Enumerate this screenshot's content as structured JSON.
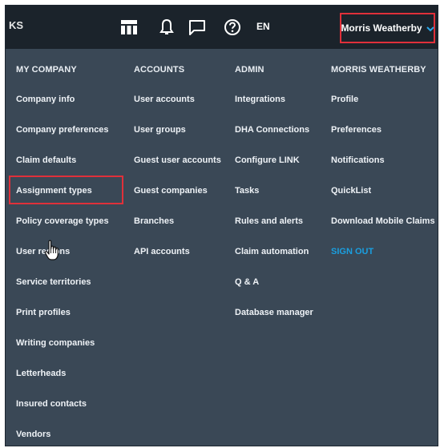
{
  "topbar": {
    "partial_label": "KS",
    "lang": "EN",
    "user_name": "Morris Weatherby",
    "icons": [
      "table-icon",
      "bell-icon",
      "chat-icon",
      "help-icon",
      "chevron-down-icon"
    ]
  },
  "menu": {
    "columns": [
      {
        "heading": "MY COMPANY",
        "items": [
          "Company info",
          "Company preferences",
          "Claim defaults",
          "Assignment types",
          "Policy coverage types",
          "User regions",
          "Service territories",
          "Print profiles",
          "Writing companies",
          "Letterheads",
          "Insured contacts",
          "Vendors"
        ]
      },
      {
        "heading": "ACCOUNTS",
        "items": [
          "User accounts",
          "User groups",
          "Guest user accounts",
          "Guest companies",
          "Branches",
          "API accounts"
        ]
      },
      {
        "heading": "ADMIN",
        "items": [
          "Integrations",
          "DHA Connections",
          "Configure LINK",
          "Tasks",
          "Rules and alerts",
          "Claim automation",
          "Q & A",
          "Database manager"
        ]
      },
      {
        "heading": "MORRIS WEATHERBY",
        "items": [
          "Profile",
          "Preferences",
          "Notifications",
          "QuickList",
          "Download Mobile Claims",
          "SIGN OUT"
        ]
      }
    ]
  },
  "colors": {
    "background": "#3a4856",
    "topbar": "#1b232b",
    "highlight": "#e0303a",
    "signout": "#1a9fe0",
    "chevron": "#2aa6e8"
  }
}
